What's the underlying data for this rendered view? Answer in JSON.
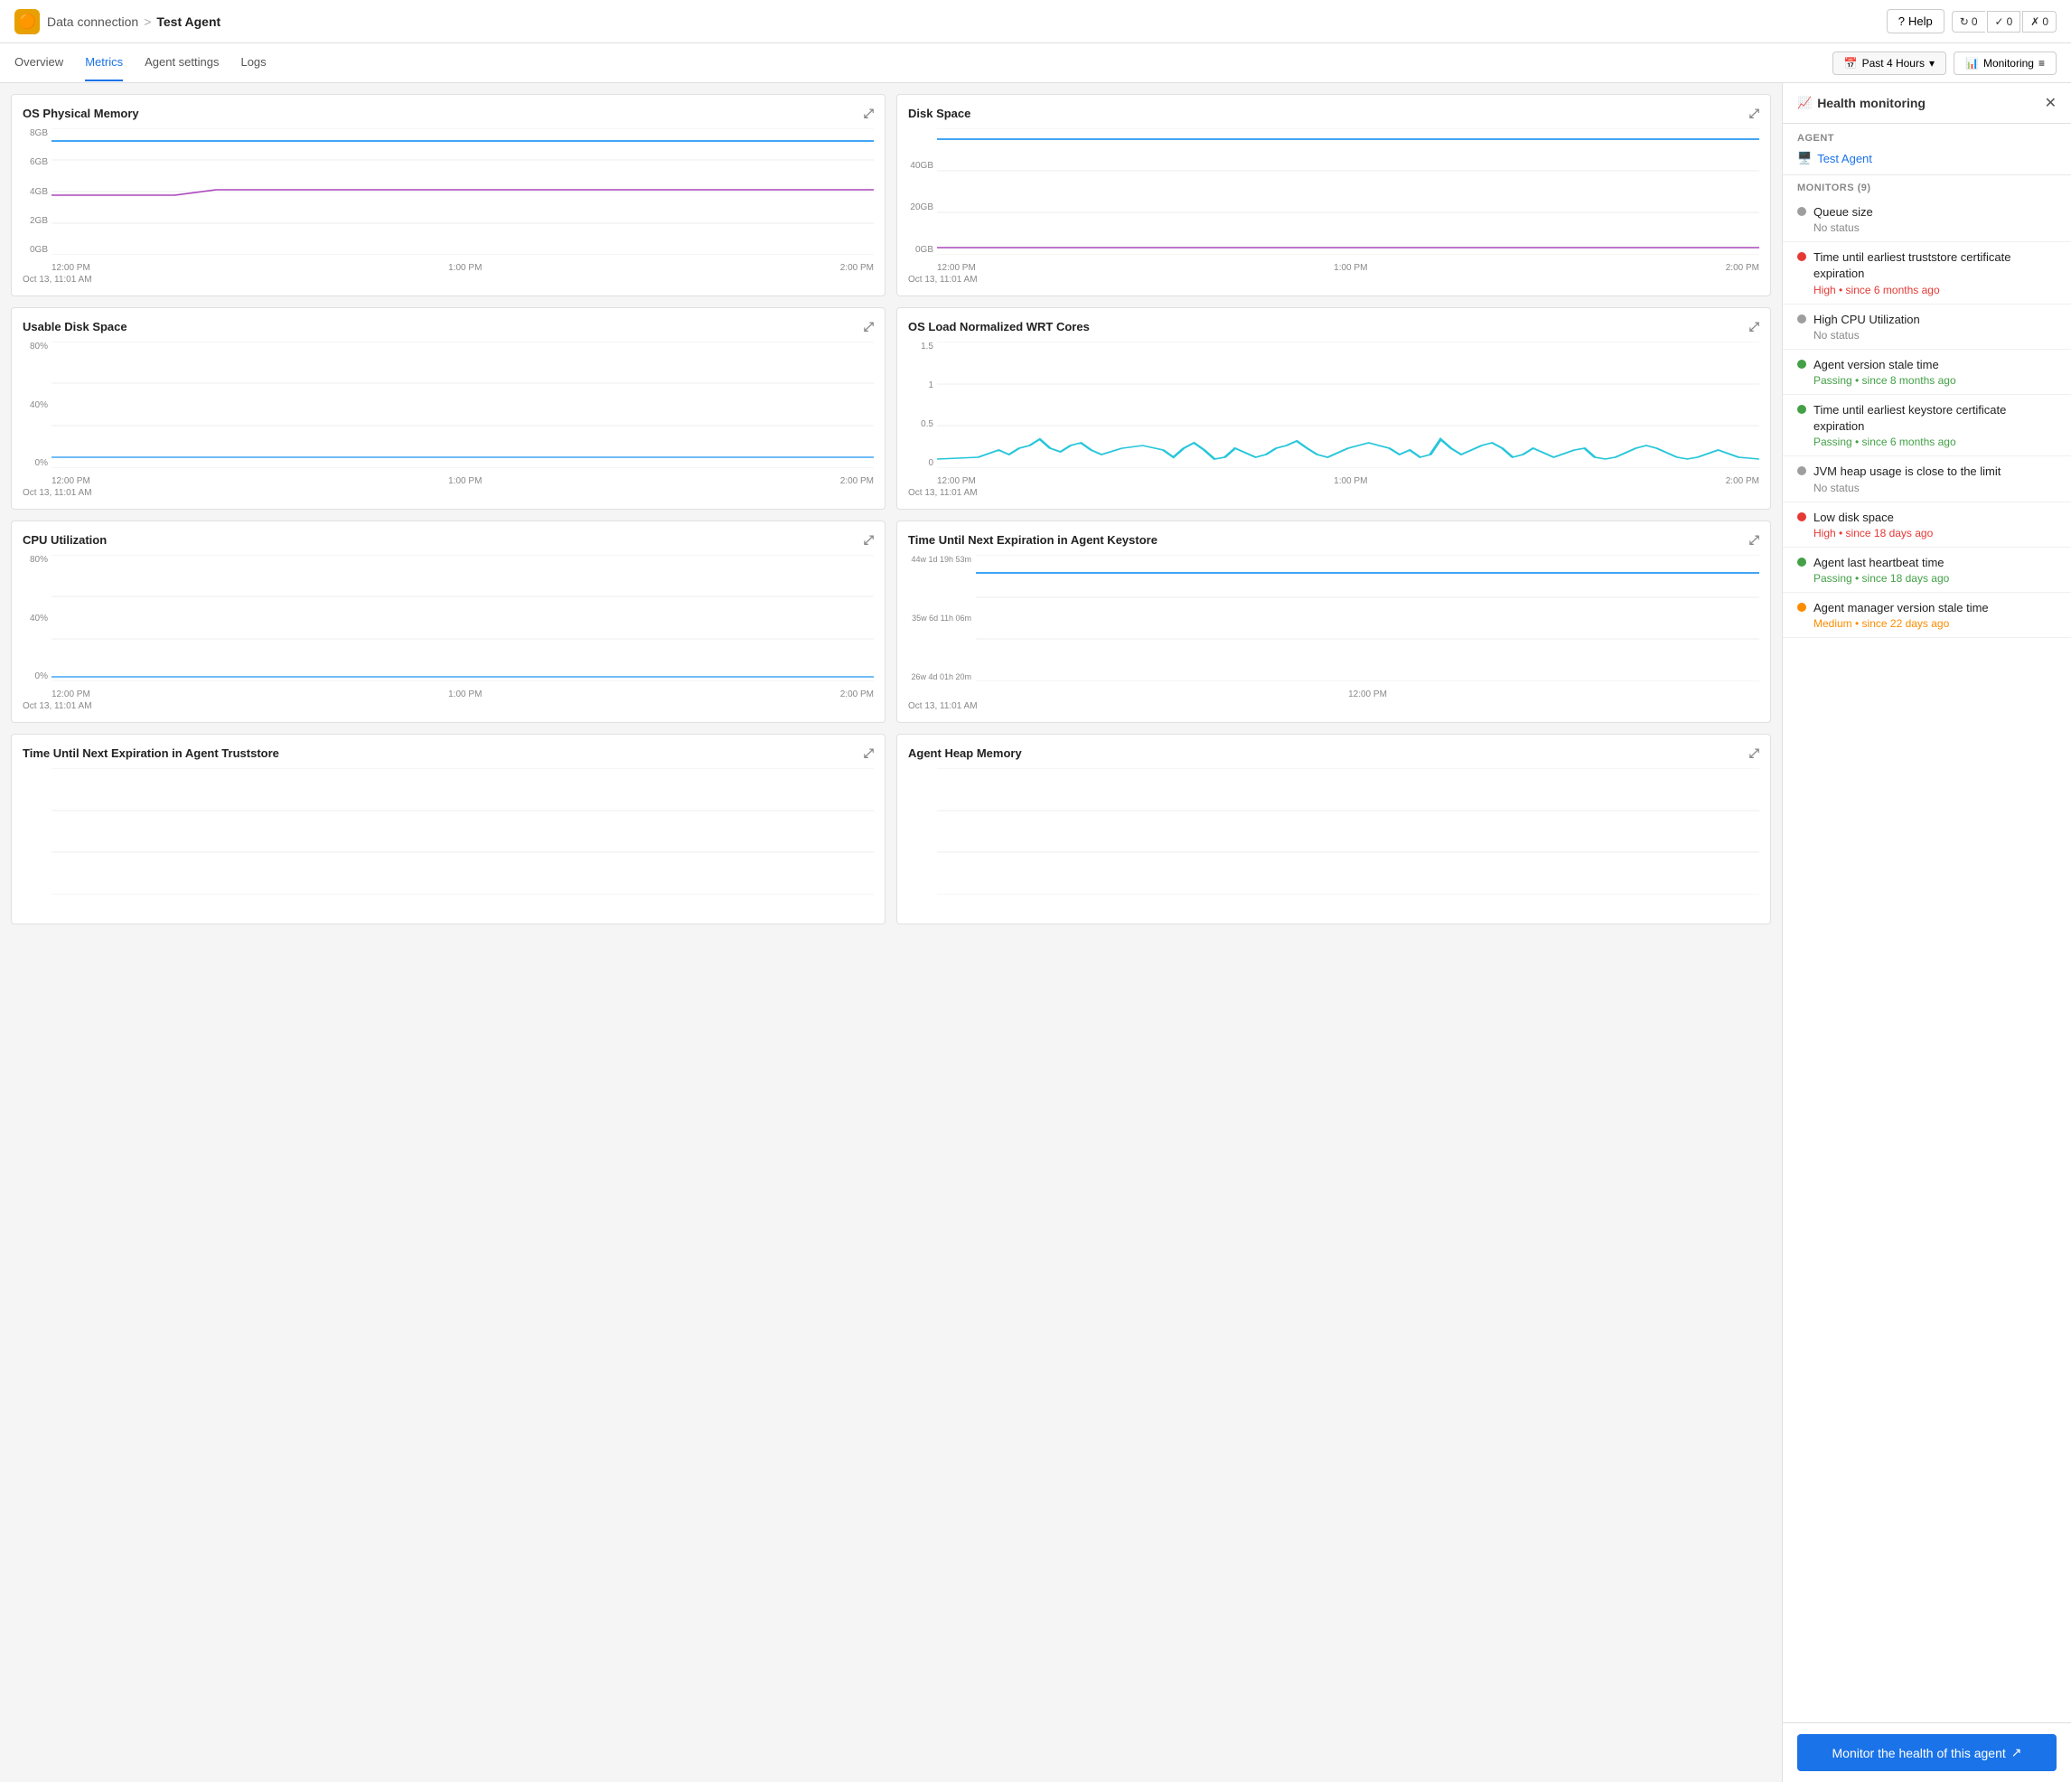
{
  "topbar": {
    "app_icon": "🟠",
    "breadcrumb_parent": "Data connection",
    "breadcrumb_sep": ">",
    "breadcrumb_current": "Test Agent",
    "help_label": "Help",
    "badges": [
      {
        "icon": "↻",
        "count": "0"
      },
      {
        "icon": "✓",
        "count": "0"
      },
      {
        "icon": "✗",
        "count": "0"
      }
    ]
  },
  "nav": {
    "tabs": [
      "Overview",
      "Metrics",
      "Agent settings",
      "Logs"
    ],
    "active_tab": "Metrics",
    "time_filter": "Past 4 Hours",
    "monitoring_label": "Monitoring"
  },
  "charts": [
    {
      "id": "os-physical-memory",
      "title": "OS Physical Memory",
      "y_labels": [
        "8GB",
        "6GB",
        "4GB",
        "2GB",
        "0GB"
      ],
      "times": [
        "12:00 PM",
        "1:00 PM",
        "2:00 PM"
      ],
      "start": "Oct 13, 11:01 AM"
    },
    {
      "id": "disk-space",
      "title": "Disk Space",
      "y_labels": [
        "",
        "40GB",
        "20GB",
        "0GB"
      ],
      "times": [
        "12:00 PM",
        "1:00 PM",
        "2:00 PM"
      ],
      "start": "Oct 13, 11:01 AM"
    },
    {
      "id": "usable-disk-space",
      "title": "Usable Disk Space",
      "y_labels": [
        "80%",
        "40%",
        "0%"
      ],
      "times": [
        "12:00 PM",
        "1:00 PM",
        "2:00 PM"
      ],
      "start": "Oct 13, 11:01 AM"
    },
    {
      "id": "os-load",
      "title": "OS Load Normalized WRT Cores",
      "y_labels": [
        "1.5",
        "1",
        "0.5",
        "0"
      ],
      "times": [
        "12:00 PM",
        "1:00 PM",
        "2:00 PM"
      ],
      "start": "Oct 13, 11:01 AM"
    },
    {
      "id": "cpu-utilization",
      "title": "CPU Utilization",
      "y_labels": [
        "80%",
        "40%",
        "0%"
      ],
      "times": [
        "12:00 PM",
        "1:00 PM",
        "2:00 PM"
      ],
      "start": "Oct 13, 11:01 AM"
    },
    {
      "id": "keystore-expiration",
      "title": "Time Until Next Expiration in Agent Keystore",
      "y_labels": [
        "44w 1d 19h 53m",
        "35w 6d 11h 06m",
        "26w 4d 01h 20m"
      ],
      "times": [
        "12:00 PM"
      ],
      "start": "Oct 13, 11:01 AM"
    },
    {
      "id": "truststore-expiration",
      "title": "Time Until Next Expiration in Agent Truststore",
      "y_labels": [],
      "times": [],
      "start": ""
    },
    {
      "id": "agent-heap-memory",
      "title": "Agent Heap Memory",
      "y_labels": [],
      "times": [],
      "start": ""
    }
  ],
  "sidebar": {
    "title": "Health monitoring",
    "agent_section": "AGENT",
    "agent_name": "Test Agent",
    "monitors_section": "MONITORS (9)",
    "monitors": [
      {
        "name": "Queue size",
        "status_text": "No status",
        "status_class": "status-no",
        "dot_class": "dot-gray"
      },
      {
        "name": "Time until earliest truststore certificate expiration",
        "status_text": "High • since 6 months ago",
        "status_class": "status-high",
        "dot_class": "dot-red"
      },
      {
        "name": "High CPU Utilization",
        "status_text": "No status",
        "status_class": "status-no",
        "dot_class": "dot-gray"
      },
      {
        "name": "Agent version stale time",
        "status_text": "Passing • since 8 months ago",
        "status_class": "status-passing",
        "dot_class": "dot-green"
      },
      {
        "name": "Time until earliest keystore certificate expiration",
        "status_text": "Passing • since 6 months ago",
        "status_class": "status-passing",
        "dot_class": "dot-green"
      },
      {
        "name": "JVM heap usage is close to the limit",
        "status_text": "No status",
        "status_class": "status-no",
        "dot_class": "dot-gray"
      },
      {
        "name": "Low disk space",
        "status_text": "High • since 18 days ago",
        "status_class": "status-high",
        "dot_class": "dot-red"
      },
      {
        "name": "Agent last heartbeat time",
        "status_text": "Passing • since 18 days ago",
        "status_class": "status-passing",
        "dot_class": "dot-green"
      },
      {
        "name": "Agent manager version stale time",
        "status_text": "Medium • since 22 days ago",
        "status_class": "status-medium",
        "dot_class": "dot-orange"
      }
    ],
    "footer_btn": "Monitor the health of this agent"
  }
}
